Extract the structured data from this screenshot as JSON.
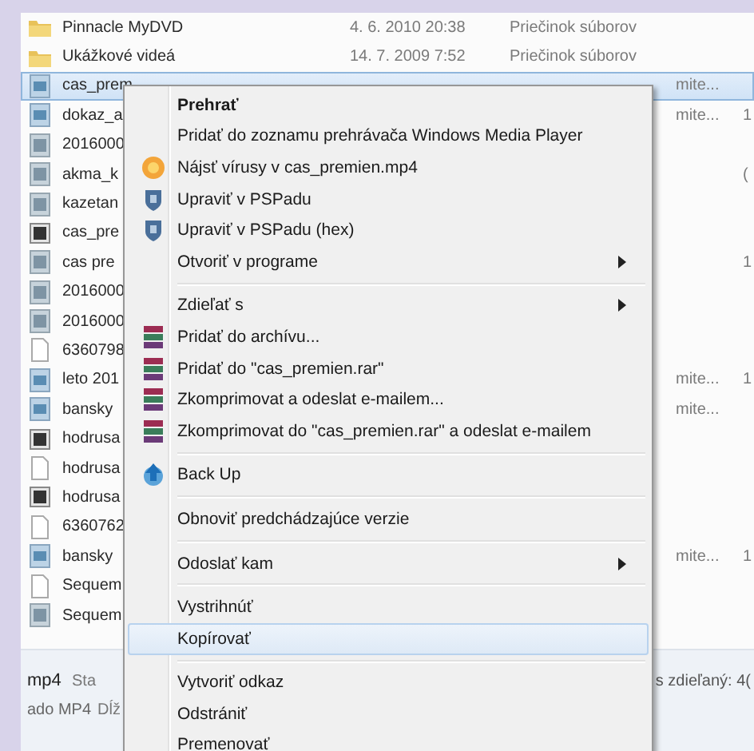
{
  "files": [
    {
      "name": "Pinnacle MyDVD",
      "kind": "folder",
      "selected": false,
      "date": "4. 6. 2010 20:38",
      "type": "Priečinok súborov"
    },
    {
      "name": "Ukážkové videá",
      "kind": "folder",
      "selected": false,
      "date": "14. 7. 2009 7:52",
      "type": "Priečinok súborov"
    },
    {
      "name": "cas_prem",
      "kind": "video",
      "selected": true,
      "column_5": "mite..."
    },
    {
      "name": "dokaz_a",
      "kind": "video",
      "selected": false,
      "column_5": "mite...",
      "column_6": "1"
    },
    {
      "name": "2016000",
      "kind": "image",
      "selected": false
    },
    {
      "name": "akma_k",
      "kind": "image",
      "selected": false,
      "column_6": "("
    },
    {
      "name": "kazetan",
      "kind": "image",
      "selected": false
    },
    {
      "name": "cas_pre",
      "kind": "photo",
      "selected": false
    },
    {
      "name": "cas pre",
      "kind": "image",
      "selected": false,
      "column_6": "1"
    },
    {
      "name": "2016000",
      "kind": "image",
      "selected": false
    },
    {
      "name": "2016000",
      "kind": "image",
      "selected": false
    },
    {
      "name": "6360798",
      "kind": "document",
      "selected": false
    },
    {
      "name": "leto 201",
      "kind": "video",
      "selected": false,
      "column_5": "mite...",
      "column_6": "1"
    },
    {
      "name": "bansky",
      "kind": "video",
      "selected": false,
      "column_5": "mite..."
    },
    {
      "name": "hodrusa",
      "kind": "photo",
      "selected": false
    },
    {
      "name": "hodrusa",
      "kind": "document",
      "selected": false
    },
    {
      "name": "hodrusa",
      "kind": "photo",
      "selected": false
    },
    {
      "name": "6360762",
      "kind": "document",
      "selected": false
    },
    {
      "name": "bansky",
      "kind": "video",
      "selected": false,
      "column_5": "mite...",
      "column_6": "1"
    },
    {
      "name": "Sequem",
      "kind": "document",
      "selected": false
    },
    {
      "name": "Sequem",
      "kind": "image",
      "selected": false
    }
  ],
  "details": {
    "name": "mp4",
    "type": "ado MP4",
    "label_1": "Sta",
    "label_2": "Dĺž",
    "shared": "s zdieľaný: 4("
  },
  "context_menu": [
    [
      {
        "label": "Prehrať",
        "default": true,
        "submenu": false,
        "selected": false
      },
      {
        "label": "Pridať do zoznamu prehrávača Windows Media Player",
        "default": false,
        "submenu": false,
        "selected": false
      },
      {
        "label": "Nájsť vírusy v cas_premien.mp4",
        "kind": "antivirus",
        "default": false,
        "submenu": false,
        "selected": false
      },
      {
        "label": "Upraviť v PSPadu",
        "kind": "pspad",
        "default": false,
        "submenu": false,
        "selected": false
      },
      {
        "label": "Upraviť v PSPadu (hex)",
        "kind": "pspad",
        "default": false,
        "submenu": false,
        "selected": false
      },
      {
        "label": "Otvoriť v programe",
        "default": false,
        "submenu": true,
        "selected": false
      }
    ],
    [
      {
        "label": "Zdieľať s",
        "default": false,
        "submenu": true,
        "selected": false
      },
      {
        "label": "Pridať do archívu...",
        "kind": "archive",
        "default": false,
        "submenu": false,
        "selected": false
      },
      {
        "label": "Pridať do \"cas_premien.rar\"",
        "kind": "archive",
        "default": false,
        "submenu": false,
        "selected": false
      },
      {
        "label": "Zkomprimovat a odeslat e-mailem...",
        "kind": "archive",
        "default": false,
        "submenu": false,
        "selected": false
      },
      {
        "label": "Zkomprimovat do \"cas_premien.rar\" a odeslat e-mailem",
        "kind": "archive",
        "default": false,
        "submenu": false,
        "selected": false
      }
    ],
    [
      {
        "label": "Back Up",
        "kind": "backup",
        "default": false,
        "submenu": false,
        "selected": false
      }
    ],
    [
      {
        "label": "Obnoviť predchádzajúce verzie",
        "default": false,
        "submenu": false,
        "selected": false
      }
    ],
    [
      {
        "label": "Odoslať kam",
        "default": false,
        "submenu": true,
        "selected": false
      }
    ],
    [
      {
        "label": "Vystrihnúť",
        "default": false,
        "submenu": false,
        "selected": false
      },
      {
        "label": "Kopírovať",
        "default": false,
        "submenu": false,
        "selected": true
      }
    ],
    [
      {
        "label": "Vytvoriť odkaz",
        "default": false,
        "submenu": false,
        "selected": false
      },
      {
        "label": "Odstrániť",
        "default": false,
        "submenu": false,
        "selected": false
      },
      {
        "label": "Premenovať",
        "default": false,
        "submenu": false,
        "selected": false
      }
    ]
  ]
}
